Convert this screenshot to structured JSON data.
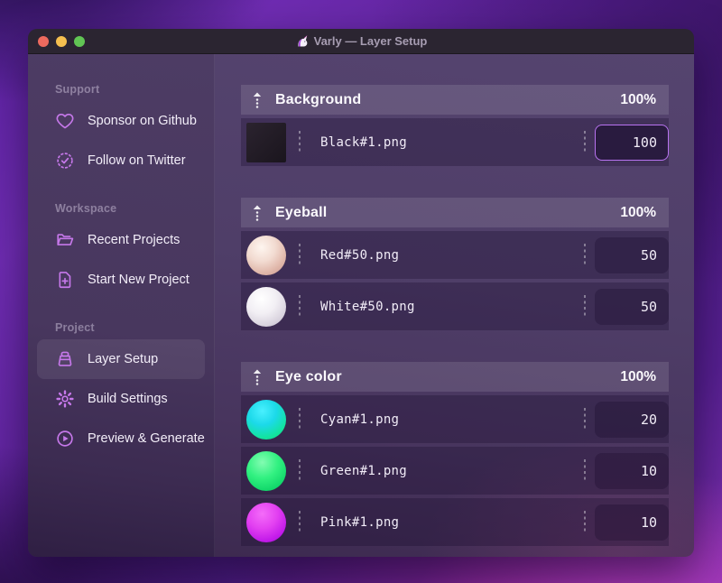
{
  "window": {
    "title": "Varly — Layer Setup",
    "title_icon": "unicorn",
    "traffic_lights": {
      "close": "#ed6a5e",
      "minimize": "#f5bf4f",
      "maximize": "#61c554"
    }
  },
  "sidebar": {
    "sections": [
      {
        "label": "Support",
        "items": [
          {
            "icon": "heart-icon",
            "label": "Sponsor on Github"
          },
          {
            "icon": "verified-badge-icon",
            "label": "Follow on Twitter"
          }
        ]
      },
      {
        "label": "Workspace",
        "items": [
          {
            "icon": "folder-open-icon",
            "label": "Recent Projects"
          },
          {
            "icon": "file-plus-icon",
            "label": "Start New Project"
          }
        ]
      },
      {
        "label": "Project",
        "items": [
          {
            "icon": "layer-box-icon",
            "label": "Layer Setup",
            "selected": true
          },
          {
            "icon": "gear-icon",
            "label": "Build Settings"
          },
          {
            "icon": "play-circle-icon",
            "label": "Preview & Generate"
          }
        ]
      }
    ]
  },
  "main": {
    "groups": [
      {
        "name": "Background",
        "opacity": "100%",
        "rows": [
          {
            "file": "Black#1.png",
            "weight": "100",
            "thumb": "black-square",
            "focused": true
          }
        ]
      },
      {
        "name": "Eyeball",
        "opacity": "100%",
        "rows": [
          {
            "file": "Red#50.png",
            "weight": "50",
            "thumb": "red-sphere"
          },
          {
            "file": "White#50.png",
            "weight": "50",
            "thumb": "white-sphere"
          }
        ]
      },
      {
        "name": "Eye color",
        "opacity": "100%",
        "rows": [
          {
            "file": "Cyan#1.png",
            "weight": "20",
            "thumb": "cyan-sphere"
          },
          {
            "file": "Green#1.png",
            "weight": "10",
            "thumb": "green-sphere"
          },
          {
            "file": "Pink#1.png",
            "weight": "10",
            "thumb": "pink-sphere"
          }
        ]
      }
    ]
  },
  "colors": {
    "accent": "#c678ea",
    "focused_input_border": "#b873f0",
    "thumb_swatches": {
      "black-square": [
        "#2b232f",
        "#1a151d"
      ],
      "red-sphere": [
        "#fef5ef",
        "#c6938b"
      ],
      "white-sphere": [
        "#ffffff",
        "#bbb3c6"
      ],
      "cyan-sphere": [
        "#49f0ff",
        "#0fd080"
      ],
      "green-sphere": [
        "#83fcb2",
        "#0abb58"
      ],
      "pink-sphere": [
        "#f46cf9",
        "#a50cd8"
      ]
    }
  }
}
